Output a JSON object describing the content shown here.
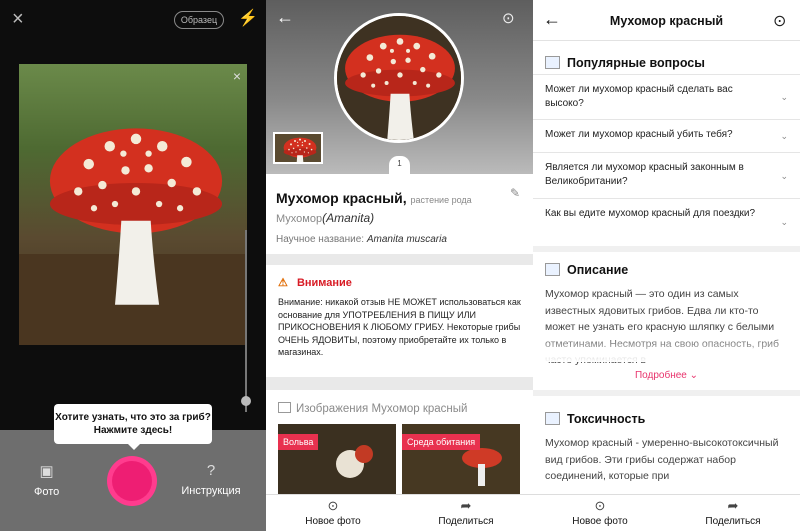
{
  "left": {
    "close_icon": "×",
    "sample_label": "Образец",
    "flash_icon": "⚡",
    "photo_close": "×",
    "tooltip": "Хотите узнать, что это за гриб? Нажмите здесь!",
    "photo_label": "Фото",
    "photo_icon": "▣",
    "help_label": "Инструкция",
    "help_icon": "?"
  },
  "middle": {
    "back_icon": "←",
    "camera_icon": "⊙",
    "page_indicator": "1",
    "name": "Мухомор красный",
    "name_suffix": "растение рода",
    "genus_ru": "Мухомор",
    "genus_lat": "(Amanita)",
    "sci_label": "Научное название:",
    "sci_name": "Amanita muscaria",
    "warning_icon": "⚠",
    "warning_title": "Внимание",
    "warning_text": "Внимание: никакой отзыв НЕ МОЖЕТ использоваться как основание для УПОТРЕБЛЕНИЯ В ПИЩУ ИЛИ ПРИКОСНОВЕНИЯ К ЛЮБОМУ ГРИБУ. Некоторые грибы ОЧЕНЬ ЯДОВИТЫ, поэтому приобретайте их только в магазинах.",
    "images_title": "Изображения Мухомор красный",
    "tags": [
      "Вольва",
      "Среда обитания"
    ]
  },
  "right": {
    "title": "Мухомор красный",
    "back_icon": "←",
    "camera_icon": "⊙",
    "faq_title": "Популярные вопросы",
    "questions": [
      "Может ли мухомор красный сделать вас высоко?",
      "Может ли мухомор красный убить тебя?",
      "Является ли мухомор красный законным в Великобритании?",
      "Как вы едите мухомор красный для поездки?"
    ],
    "description_title": "Описание",
    "description_text": "Мухомор красный — это один из самых известных ядовитых грибов. Едва ли кто-то может не узнать его красную шляпку с белыми отметинами. Несмотря на свою опасность, гриб часто упоминается в",
    "more_label": "Подробнее ⌄",
    "toxicity_title": "Токсичность",
    "toxicity_text": "Мухомор красный - умеренно-высокотоксичный вид грибов. Эти грибы содержат набор соединений, которые при"
  },
  "nav": {
    "new_photo": "Новое фото",
    "share": "Поделиться",
    "camera_icon": "⊙",
    "share_icon": "➦"
  },
  "colors": {
    "accent": "#ee1e73",
    "warning": "#d81b25",
    "tag": "#e8314f"
  }
}
